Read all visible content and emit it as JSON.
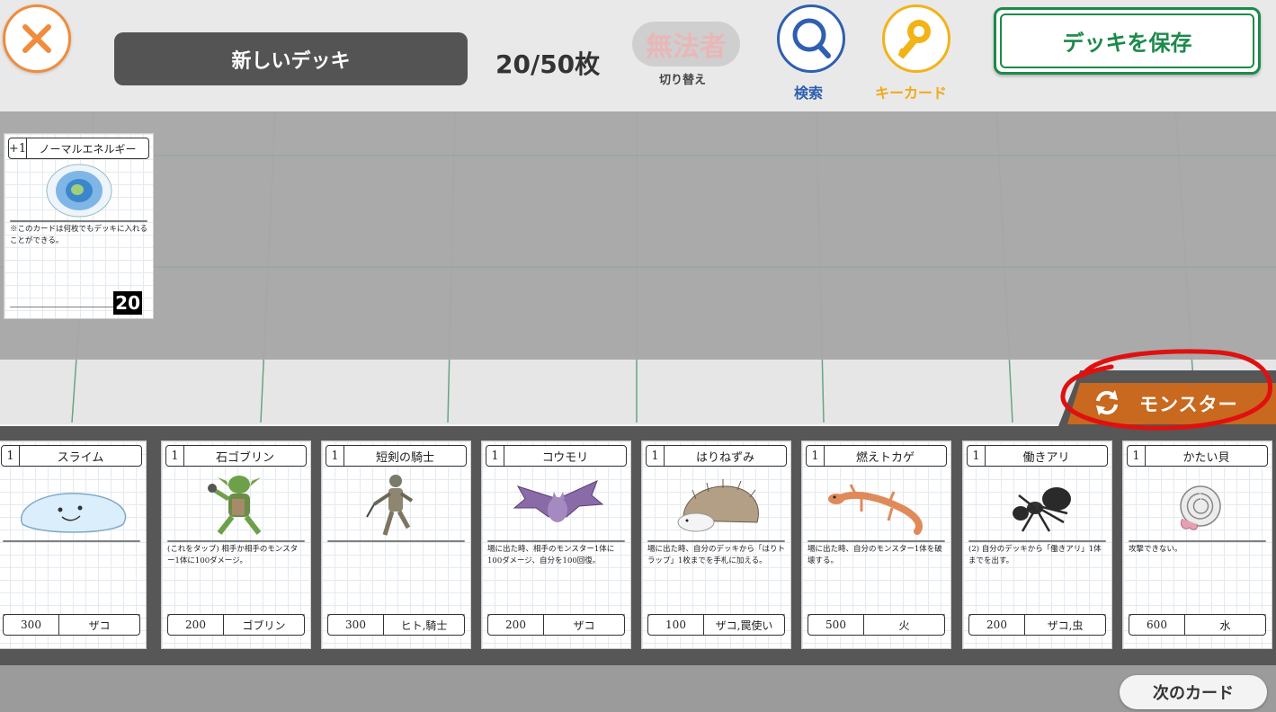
{
  "header": {
    "deck_name": "新しいデッキ",
    "deck_count": "20/50枚",
    "lawless_title": "無法者",
    "lawless_sub": "切り替え",
    "search_label": "検索",
    "keycard_label": "キーカード",
    "save_label": "デッキを保存"
  },
  "deck": {
    "cards": [
      {
        "cost": "+1",
        "name": "ノーマルエネルギー",
        "desc": "※このカードは何枚でもデッキに入れることができる。",
        "count": "20"
      }
    ]
  },
  "filter_tab": {
    "label": "モンスター"
  },
  "pool": {
    "cards": [
      {
        "cost": "1",
        "name": "スライム",
        "desc": "",
        "hp": "300",
        "tribe": "ザコ",
        "art": "slime-art"
      },
      {
        "cost": "1",
        "name": "石ゴブリン",
        "desc": "(これをタップ) 相手か相手のモンスター1体に100ダメージ。",
        "hp": "200",
        "tribe": "ゴブリン",
        "art": "goblin-art"
      },
      {
        "cost": "1",
        "name": "短剣の騎士",
        "desc": "",
        "hp": "300",
        "tribe": "ヒト,騎士",
        "art": "knight-art"
      },
      {
        "cost": "1",
        "name": "コウモリ",
        "desc": "場に出た時、相手のモンスター1体に100ダメージ、自分を100回復。",
        "hp": "200",
        "tribe": "ザコ",
        "art": "bat-art"
      },
      {
        "cost": "1",
        "name": "はりねずみ",
        "desc": "場に出た時、自分のデッキから「はりトラップ」1枚までを手札に加える。",
        "hp": "100",
        "tribe": "ザコ,罠使い",
        "art": "hedgehog-art"
      },
      {
        "cost": "1",
        "name": "燃えトカゲ",
        "desc": "場に出た時、自分のモンスター1体を破壊する。",
        "hp": "500",
        "tribe": "火",
        "art": "lizard-art"
      },
      {
        "cost": "1",
        "name": "働きアリ",
        "desc": "(2) 自分のデッキから「働きアリ」1体までを出す。",
        "hp": "200",
        "tribe": "ザコ,虫",
        "art": "ant-art"
      },
      {
        "cost": "1",
        "name": "かたい貝",
        "desc": "攻撃できない。",
        "hp": "600",
        "tribe": "水",
        "art": "shell-art"
      }
    ]
  },
  "footer": {
    "next_label": "次のカード"
  },
  "colors": {
    "close_orange": "#f08c3c",
    "search_blue": "#2f5fb0",
    "key_yellow": "#f2b317",
    "save_green": "#1c8a4a",
    "tab_orange": "#c8691f",
    "highlight_red": "#e01010"
  }
}
